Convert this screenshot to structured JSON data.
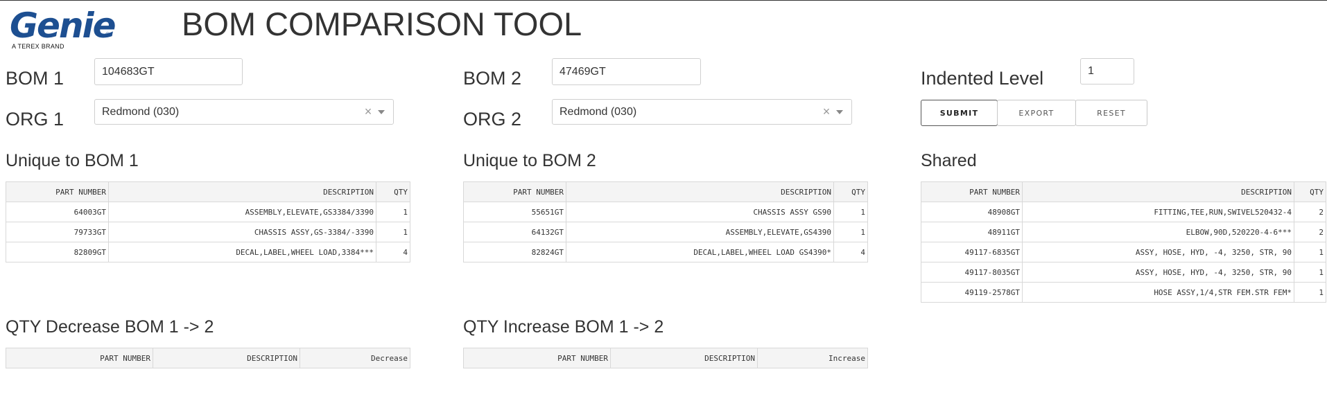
{
  "header": {
    "logo_text": "Genie",
    "logo_reg": "®",
    "logo_subtitle": "A TEREX BRAND",
    "title": "BOM COMPARISON TOOL"
  },
  "form": {
    "bom1_label": "BOM 1",
    "bom1_value": "104683GT",
    "org1_label": "ORG 1",
    "org1_value": "Redmond (030)",
    "bom2_label": "BOM 2",
    "bom2_value": "47469GT",
    "org2_label": "ORG 2",
    "org2_value": "Redmond (030)",
    "indent_label": "Indented Level",
    "indent_value": "1",
    "clear_glyph": "×",
    "buttons": {
      "submit": "SUBMIT",
      "export": "EXPORT",
      "reset": "RESET"
    }
  },
  "sections": {
    "unique1": {
      "title": "Unique to BOM 1",
      "headers": [
        "PART NUMBER",
        "DESCRIPTION",
        "QTY"
      ],
      "rows": [
        [
          "64003GT",
          "ASSEMBLY,ELEVATE,GS3384/3390",
          "1"
        ],
        [
          "79733GT",
          "CHASSIS ASSY,GS-3384/-3390",
          "1"
        ],
        [
          "82809GT",
          "DECAL,LABEL,WHEEL LOAD,3384***",
          "4"
        ]
      ]
    },
    "unique2": {
      "title": "Unique to BOM 2",
      "headers": [
        "PART NUMBER",
        "DESCRIPTION",
        "QTY"
      ],
      "rows": [
        [
          "55651GT",
          "CHASSIS ASSY GS90",
          "1"
        ],
        [
          "64132GT",
          "ASSEMBLY,ELEVATE,GS4390",
          "1"
        ],
        [
          "82824GT",
          "DECAL,LABEL,WHEEL LOAD GS4390*",
          "4"
        ]
      ]
    },
    "shared": {
      "title": "Shared",
      "headers": [
        "PART NUMBER",
        "DESCRIPTION",
        "QTY"
      ],
      "rows": [
        [
          "48908GT",
          "FITTING,TEE,RUN,SWIVEL520432-4",
          "2"
        ],
        [
          "48911GT",
          "ELBOW,90D,520220-4-6***",
          "2"
        ],
        [
          "49117-6835GT",
          "ASSY, HOSE, HYD, -4, 3250, STR, 90",
          "1"
        ],
        [
          "49117-8035GT",
          "ASSY, HOSE, HYD, -4, 3250, STR, 90",
          "1"
        ],
        [
          "49119-2578GT",
          "HOSE ASSY,1/4,STR FEM.STR FEM*",
          "1"
        ]
      ]
    },
    "decrease": {
      "title": "QTY Decrease BOM 1 -> 2",
      "headers": [
        "PART NUMBER",
        "DESCRIPTION",
        "Decrease"
      ]
    },
    "increase": {
      "title": "QTY Increase BOM 1 -> 2",
      "headers": [
        "PART NUMBER",
        "DESCRIPTION",
        "Increase"
      ]
    }
  },
  "colors": {
    "brand": "#1d4f91",
    "text": "#333333",
    "border": "#d8d8d8",
    "header_bg": "#f4f4f4"
  }
}
